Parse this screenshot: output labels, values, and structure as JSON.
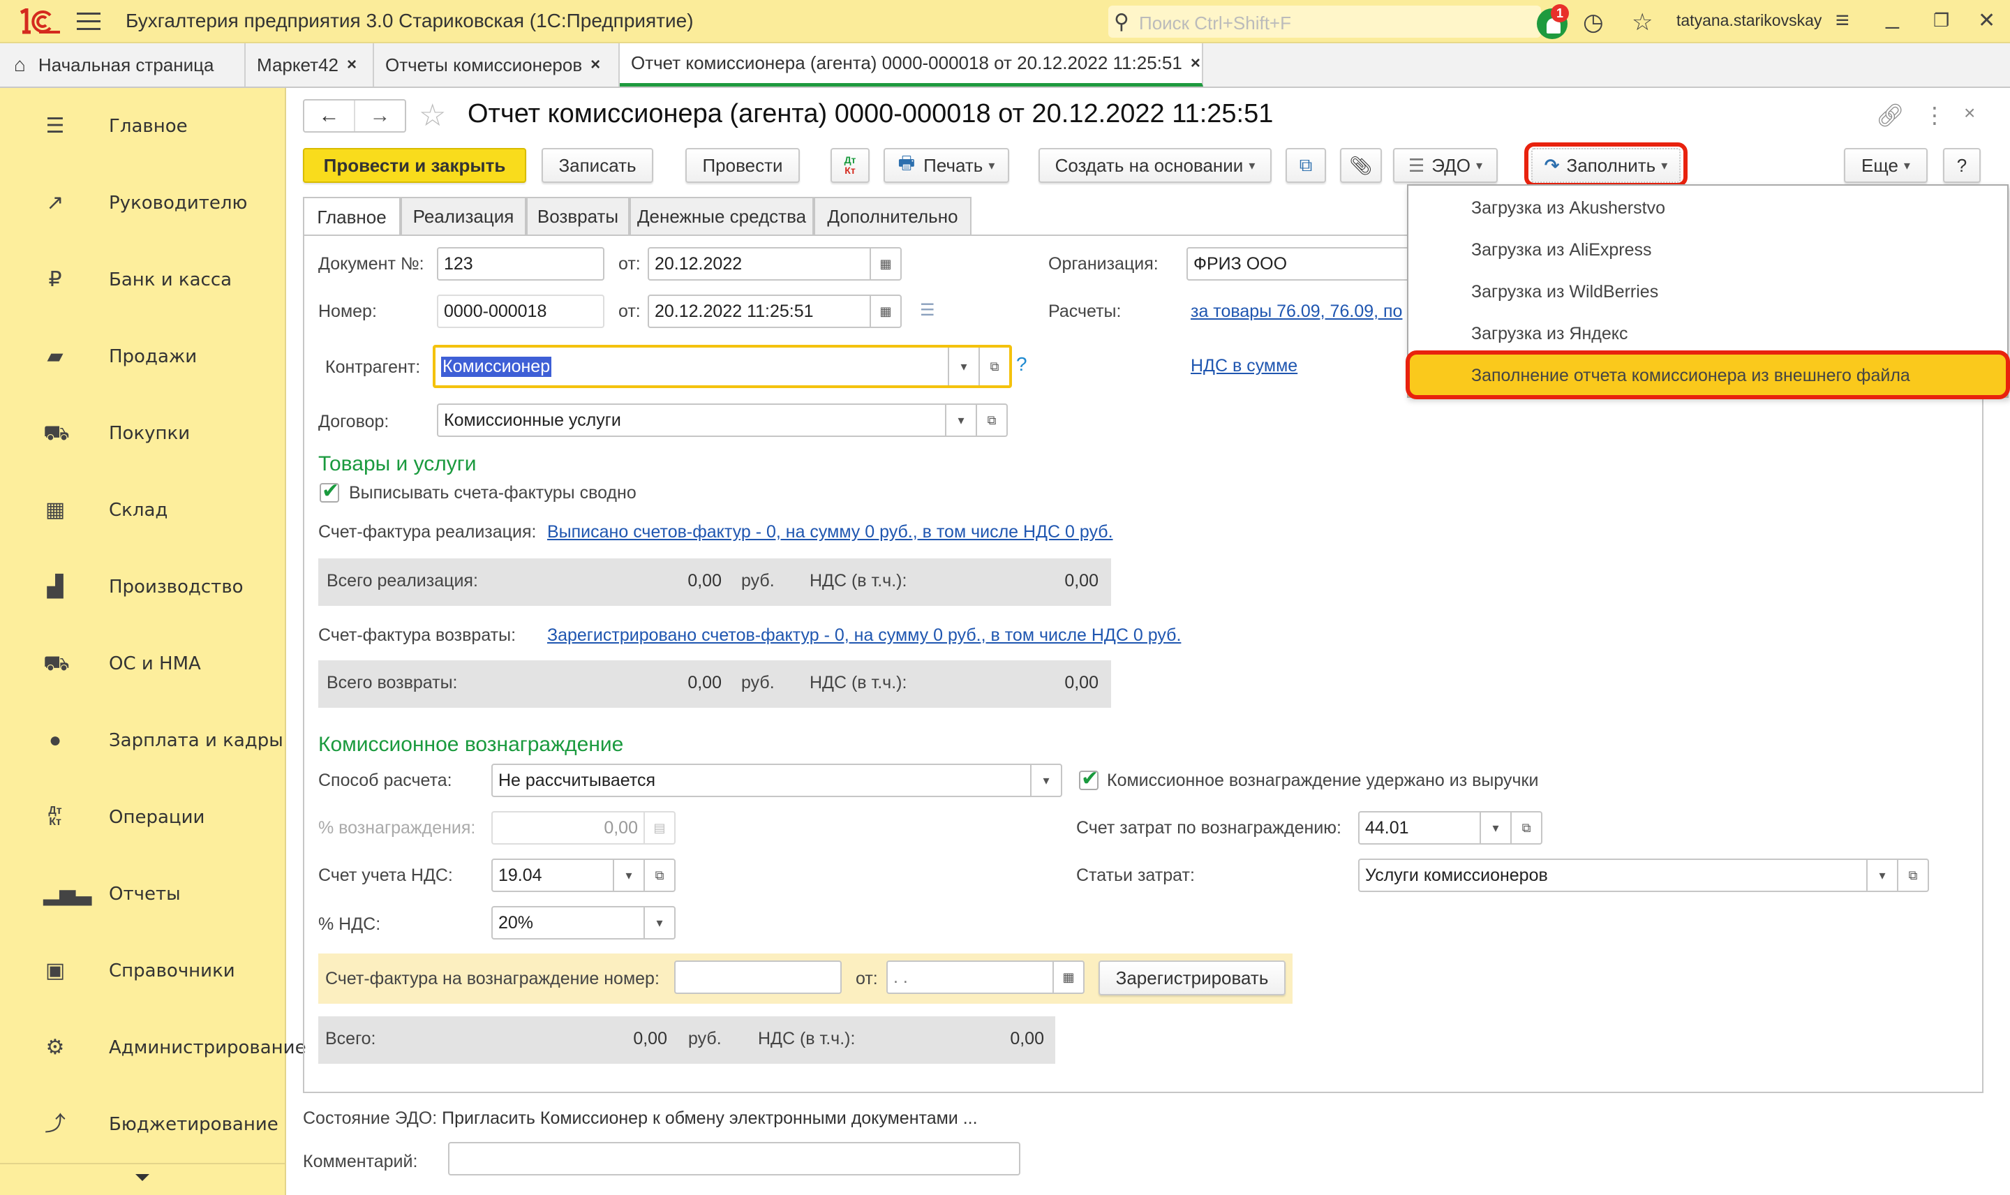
{
  "titlebar": {
    "app_title": "Бухгалтерия предприятия 3.0 Стариковская  (1С:Предприятие)",
    "search_placeholder": "Поиск Ctrl+Shift+F",
    "notification_count": "1",
    "user": "tatyana.starikovskay"
  },
  "open_tabs": [
    {
      "label": "Начальная страница"
    },
    {
      "label": "Маркет42"
    },
    {
      "label": "Отчеты комиссионеров"
    },
    {
      "label": "Отчет комиссионера (агента) 0000-000018 от 20.12.2022 11:25:51",
      "active": true
    }
  ],
  "sidebar": {
    "items": [
      {
        "label": "Главное",
        "icon": "menu-lines-icon"
      },
      {
        "label": "Руководителю",
        "icon": "trend-icon"
      },
      {
        "label": "Банк и касса",
        "icon": "ruble-icon"
      },
      {
        "label": "Продажи",
        "icon": "shopping-bag-icon"
      },
      {
        "label": "Покупки",
        "icon": "cart-icon"
      },
      {
        "label": "Склад",
        "icon": "warehouse-icon"
      },
      {
        "label": "Производство",
        "icon": "factory-icon"
      },
      {
        "label": "ОС и НМА",
        "icon": "truck-icon"
      },
      {
        "label": "Зарплата и кадры",
        "icon": "person-icon"
      },
      {
        "label": "Операции",
        "icon": "dt-kt-icon"
      },
      {
        "label": "Отчеты",
        "icon": "bar-chart-icon"
      },
      {
        "label": "Справочники",
        "icon": "books-icon"
      },
      {
        "label": "Администрирование",
        "icon": "gear-icon"
      },
      {
        "label": "Бюджетирование",
        "icon": "budget-icon"
      }
    ]
  },
  "document": {
    "title": "Отчет комиссионера (агента) 0000-000018 от 20.12.2022 11:25:51"
  },
  "toolbar": {
    "post_close": "Провести и закрыть",
    "save": "Записать",
    "post": "Провести",
    "dtkt_top": "Дт",
    "dtkt_bottom": "Кт",
    "print": "Печать",
    "create_based": "Создать на основании",
    "edo": "ЭДО",
    "fill": "Заполнить",
    "more": "Еще",
    "help": "?"
  },
  "fill_menu": {
    "items": [
      {
        "label": "Загрузка из Akusherstvo"
      },
      {
        "label": "Загрузка из AliExpress"
      },
      {
        "label": "Загрузка из WildBerries"
      },
      {
        "label": "Загрузка из Яндекс"
      },
      {
        "label": "Заполнение отчета комиссионера из внешнего  файла",
        "highlighted": true
      }
    ]
  },
  "form_tabs": [
    {
      "label": "Главное",
      "active": true
    },
    {
      "label": "Реализация"
    },
    {
      "label": "Возвраты"
    },
    {
      "label": "Денежные средства"
    },
    {
      "label": "Дополнительно"
    }
  ],
  "form": {
    "doc_no_label": "Документ №:",
    "doc_no": "123",
    "from_label": "от:",
    "doc_date": "20.12.2022",
    "number_label": "Номер:",
    "number": "0000-000018",
    "number_date": "20.12.2022 11:25:51",
    "org_label": "Организация:",
    "org": "ФРИЗ ООО",
    "settlements_label": "Расчеты:",
    "settlements_link": "за товары 76.09, 76.09, по",
    "vat_link": "НДС в сумме",
    "counterparty_label": "Контрагент:",
    "counterparty": "Комиссионер",
    "contract_label": "Договор:",
    "contract": "Комиссионные услуги",
    "help_q": "?"
  },
  "goods": {
    "section": "Товары и услуги",
    "summary_invoices_label": "Выписывать счета-фактуры сводно",
    "summary_invoices_checked": true,
    "sale_invoice_label": "Счет-фактура реализация:",
    "sale_invoice_link": "Выписано счетов-фактур - 0, на сумму 0 руб., в том числе НДС 0 руб.",
    "sale_total_label": "Всего реализация:",
    "sale_total": "0,00",
    "currency": "руб.",
    "vat_incl_label": "НДС (в т.ч.):",
    "sale_vat": "0,00",
    "return_invoice_label": "Счет-фактура возвраты:",
    "return_invoice_link": "Зарегистрировано счетов-фактур - 0, на сумму 0 руб., в том числе НДС 0 руб.",
    "return_total_label": "Всего возвраты:",
    "return_total": "0,00",
    "return_vat": "0,00"
  },
  "commission": {
    "section": "Комиссионное вознаграждение",
    "method_label": "Способ расчета:",
    "method": "Не рассчитывается",
    "percent_label": "% вознаграждения:",
    "percent": "0,00",
    "vat_account_label": "Счет учета НДС:",
    "vat_account": "19.04",
    "vat_rate_label": "% НДС:",
    "vat_rate": "20%",
    "withheld_label": "Комиссионное вознаграждение удержано из выручки",
    "withheld_checked": true,
    "cost_account_label": "Счет затрат по вознаграждению:",
    "cost_account": "44.01",
    "cost_items_label": "Статьи затрат:",
    "cost_items": "Услуги комиссионеров",
    "invoice_label": "Счет-фактура на вознаграждение номер:",
    "invoice_no": "",
    "invoice_from_label": "от:",
    "invoice_date": " .  .",
    "register_btn": "Зарегистрировать",
    "total_label": "Всего:",
    "total": "0,00",
    "total_vat": "0,00"
  },
  "footer": {
    "edo_status_label": "Состояние ЭДО:",
    "edo_status": "Пригласить Комиссионер к обмену электронными документами ...",
    "comment_label": "Комментарий:",
    "comment": ""
  },
  "colors": {
    "brand_yellow": "#fdee9c",
    "primary_button": "#f9dc1c",
    "accent_green": "#1a9a3e",
    "highlight_red": "#e8220e",
    "link_blue": "#1f56b0"
  }
}
